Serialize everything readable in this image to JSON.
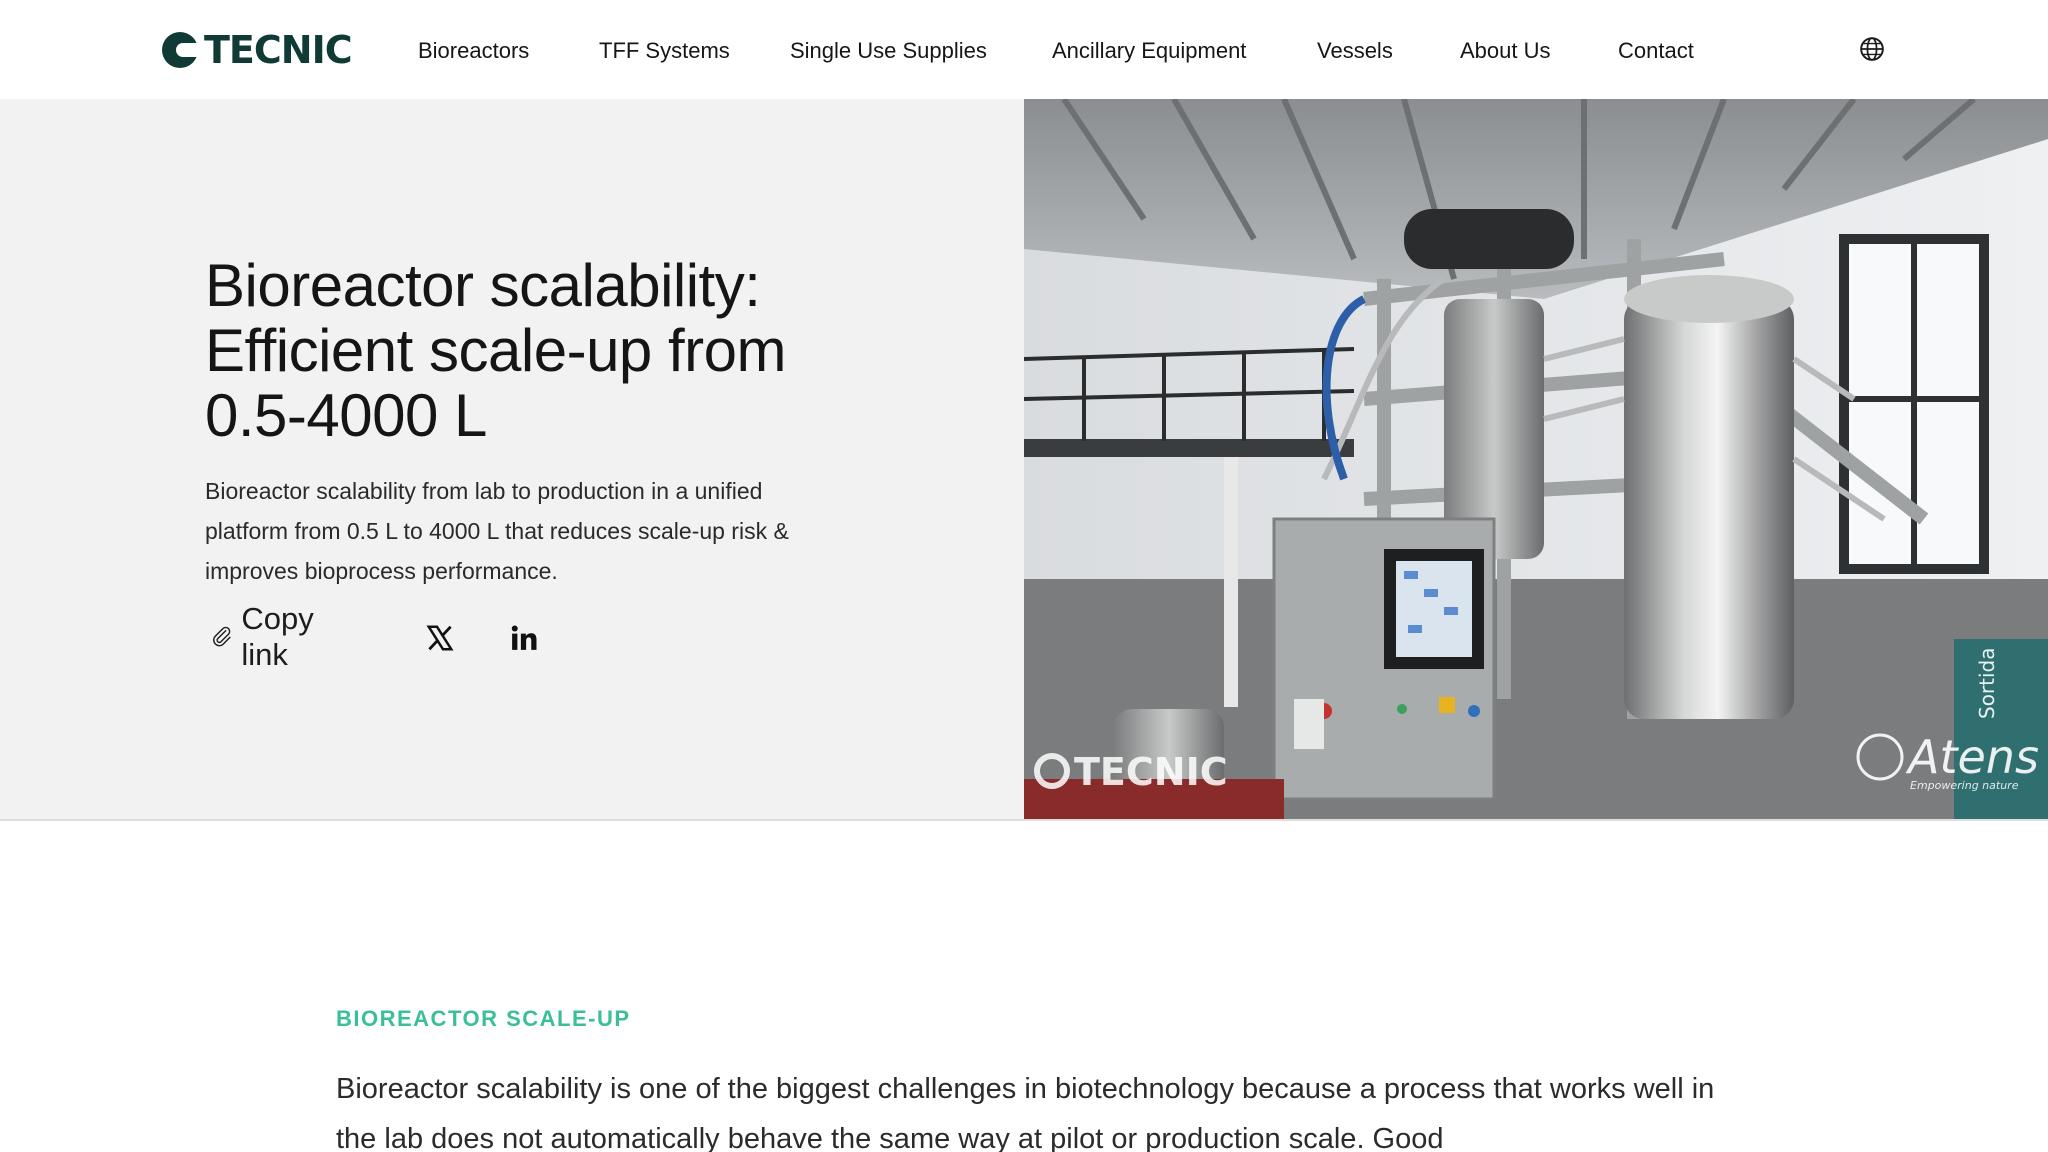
{
  "brand": {
    "name": "TECNIC"
  },
  "nav": {
    "items": [
      {
        "label": "Bioreactors"
      },
      {
        "label": "TFF Systems"
      },
      {
        "label": "Single Use Supplies"
      },
      {
        "label": "Ancillary Equipment"
      },
      {
        "label": "Vessels"
      },
      {
        "label": "About Us"
      },
      {
        "label": "Contact"
      }
    ],
    "language_icon": "globe-icon"
  },
  "hero": {
    "title": "Bioreactor scalability: Efficient scale-up from 0.5-4000 L",
    "description": "Bioreactor scalability from lab to production in a unified platform from 0.5 L to 4000 L that reduces scale-up risk & improves bioprocess performance.",
    "share": {
      "copy_label": "Copy link",
      "copy_icon": "paperclip-icon",
      "x_icon": "x-icon",
      "linkedin_icon": "linkedin-icon"
    },
    "image": {
      "watermark_left": "TECNIC",
      "watermark_right": "Atens",
      "watermark_right_tagline": "Empowering nature",
      "door_sign": "Sortida"
    }
  },
  "content": {
    "eyebrow": "BIOREACTOR SCALE-UP",
    "lead": "Bioreactor scalability is one of the biggest challenges in biotechnology because a process that works well in the lab does not automatically behave the same way at pilot or production scale. Good"
  },
  "colors": {
    "brand_dark": "#0f3a36",
    "accent_green": "#3bbf98",
    "hero_bg": "#f2f2f2"
  }
}
